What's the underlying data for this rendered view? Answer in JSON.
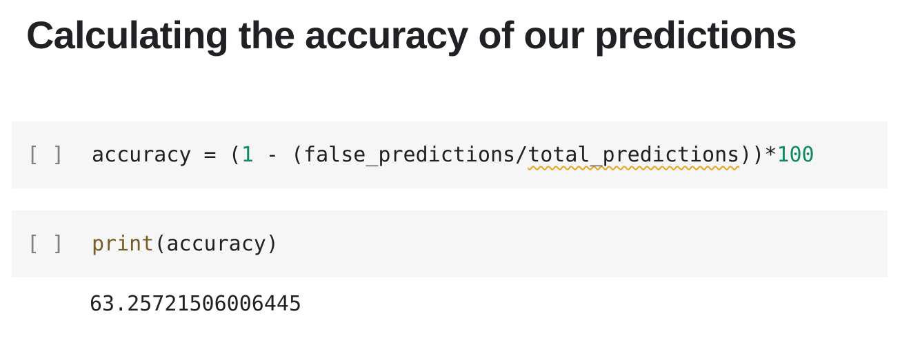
{
  "heading": "Calculating the accuracy of our predictions",
  "cells": [
    {
      "run_label": "[ ]",
      "code": {
        "t1": "accuracy = (",
        "n1": "1",
        "t2": " - (false_predictions/",
        "squiggle": "total_predictions",
        "t3": "))*",
        "n2": "100"
      }
    },
    {
      "run_label": "[ ]",
      "code": {
        "fn": "print",
        "t1": "(accuracy)"
      }
    }
  ],
  "output": "63.25721506006445",
  "colors": {
    "number": "#0d8a62",
    "function": "#795e26",
    "warning_underline": "#e8a317",
    "cell_background": "#f6f6f6"
  }
}
